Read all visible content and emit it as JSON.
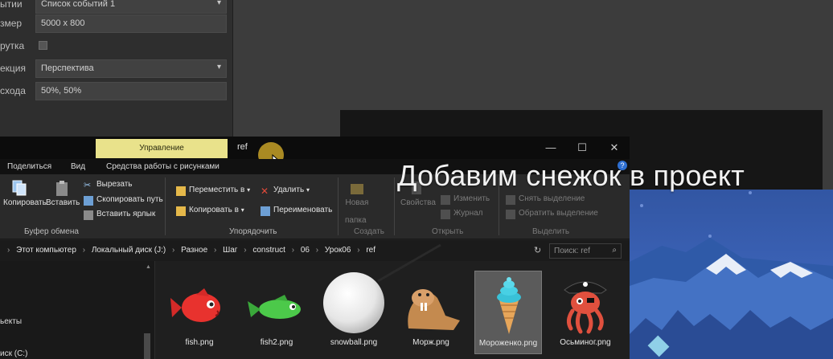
{
  "properties": {
    "rows": [
      {
        "label": "ытии",
        "value": "Список событий 1",
        "dropdown": true
      },
      {
        "label": "змер",
        "value": "5000 x 800",
        "dropdown": false
      },
      {
        "label": "рутка",
        "value": "",
        "checkbox": true
      },
      {
        "label": "екция",
        "value": "Перспектива",
        "dropdown": true
      },
      {
        "label": "схода",
        "value": "50%, 50%",
        "dropdown": false
      }
    ]
  },
  "caption": "Добавим снежок в проект",
  "explorer": {
    "manage_tab": "Управление",
    "title": "ref",
    "controls": {
      "minimize": "—",
      "maximize": "☐",
      "close": "✕"
    },
    "tabs": {
      "share": "Поделиться",
      "view": "Вид",
      "picture_tools": "Средства работы с рисунками"
    },
    "ribbon": {
      "copy": "Копировать",
      "paste": "Вставить",
      "cut": "Вырезать",
      "copy_path": "Скопировать путь",
      "paste_shortcut": "Вставить ярлык",
      "clipboard_group": "Буфер обмена",
      "move_to": "Переместить в",
      "copy_to": "Копировать в",
      "delete": "Удалить",
      "rename": "Переименовать",
      "organize_group": "Упорядочить",
      "new_folder_1": "Новая",
      "new_folder_2": "папка",
      "create_group": "Создать",
      "properties": "Свойства",
      "edit": "Изменить",
      "history": "Журнал",
      "open_group": "Открыть",
      "select_none": "Снять выделение",
      "invert_selection": "Обратить выделение",
      "select_group": "Выделить"
    },
    "address": [
      "Этот компьютер",
      "Локальный диск (J:)",
      "Разное",
      "Шаг",
      "construct",
      "06",
      "Урок06",
      "ref"
    ],
    "search_placeholder": "Поиск: ref",
    "nav": {
      "item1": "ьекты",
      "item2": "иск (C:)"
    },
    "files": [
      {
        "name": "fish.png",
        "icon": "red-fish"
      },
      {
        "name": "fish2.png",
        "icon": "green-fish"
      },
      {
        "name": "snowball.png",
        "icon": "snowball"
      },
      {
        "name": "Морж.png",
        "icon": "walrus"
      },
      {
        "name": "Мороженко.png",
        "icon": "ice-cream",
        "selected": true
      },
      {
        "name": "Осьминог.png",
        "icon": "pirate-octopus"
      }
    ]
  },
  "colors": {
    "manage_tab": "#e9e28b",
    "game_bg": "#3c63b8",
    "cursor_highlight": "#c7a128"
  }
}
